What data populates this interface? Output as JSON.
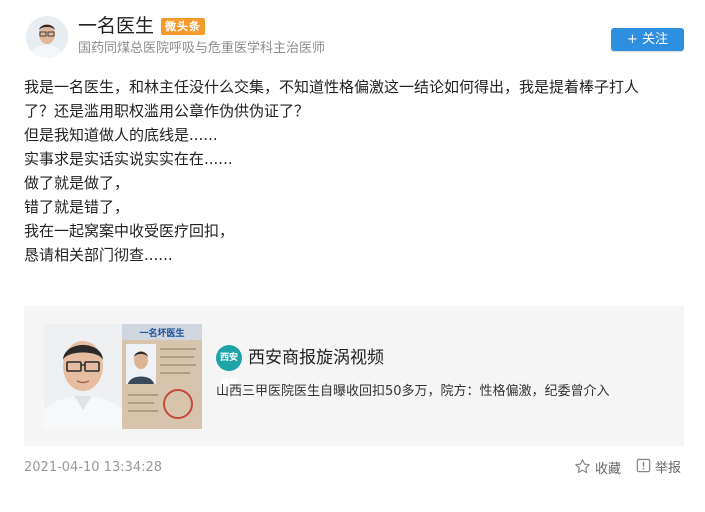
{
  "author": {
    "name": "一名医生",
    "badge": "微头条",
    "title": "国药同煤总医院呼吸与危重医学科主治医师",
    "avatar_icon": "doctor-avatar"
  },
  "follow_button": {
    "label": "+ 关注",
    "color": "#2e8ee0"
  },
  "post": {
    "lines": [
      "我是一名医生，和林主任没什么交集，不知道性格偏激这一结论如何得出，我是提着棒子打人",
      "了？还是滥用职权滥用公章作伪供伪证了？",
      "但是我知道做人的底线是......",
      "实事求是实话实说实实在在......",
      "做了就是做了，",
      "错了就是错了，",
      "我在一起窝案中收受医疗回扣，",
      "恳请相关部门彻查......"
    ]
  },
  "card": {
    "source_logo_text": "西安商报",
    "source_name": "西安商报旋涡视频",
    "title": "山西三甲医院医生自曝收回扣50多万，院方：性格偏激，纪委曾介入",
    "thumb_text": "一名坏医生",
    "logo_color": "#1ea4a6"
  },
  "footer": {
    "timestamp": "2021-04-10 13:34:28",
    "favorite_label": "收藏",
    "report_label": "举报",
    "favorite_icon": "star-icon",
    "report_icon": "report-icon"
  }
}
